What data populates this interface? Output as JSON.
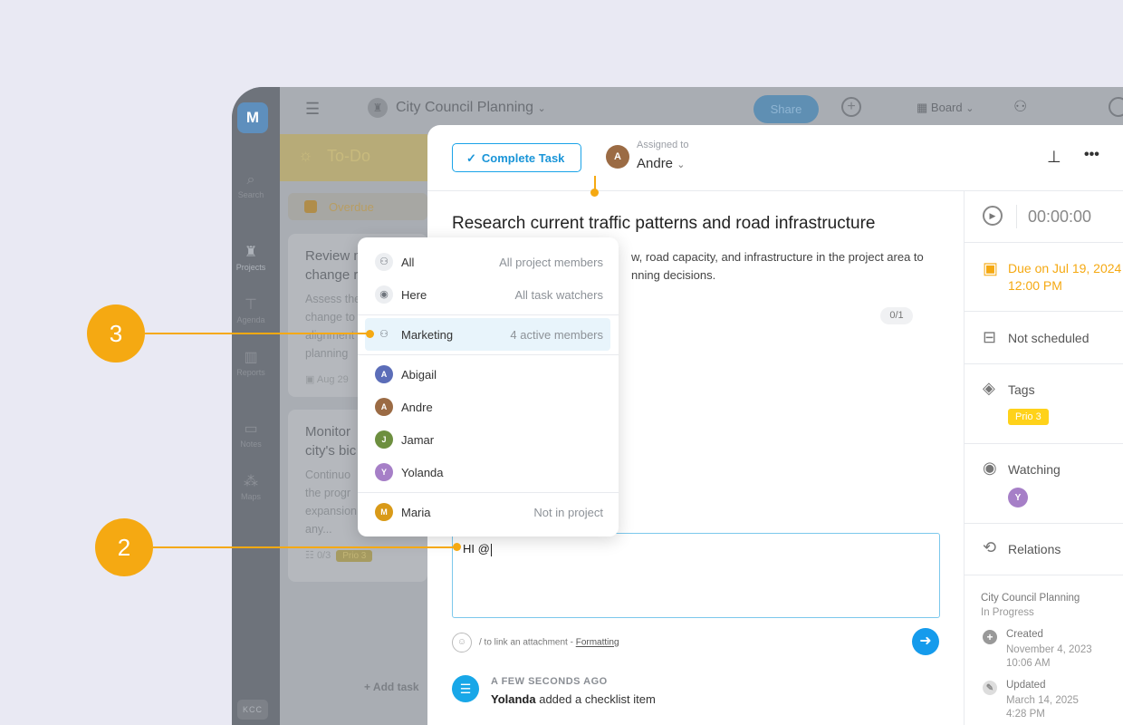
{
  "rail": {
    "logo": "M",
    "items": [
      {
        "label": "Search",
        "glyph": "⚲"
      },
      {
        "label": "Projects",
        "glyph": "♜"
      },
      {
        "label": "Agenda",
        "glyph": "⚲"
      },
      {
        "label": "Reports",
        "glyph": "▥"
      },
      {
        "label": "Notes",
        "glyph": "▭"
      },
      {
        "label": "Maps",
        "glyph": "⁂"
      }
    ],
    "workspace": "KCC"
  },
  "topbar": {
    "project_title": "City Council Planning",
    "share": "Share",
    "board": "Board"
  },
  "column": {
    "title": "To-Do",
    "overdue": "Overdue",
    "card1": {
      "title": "Review m\nchange r",
      "desc": "Assess the\nchange to\nalignment\nplanning",
      "date": "Aug 29"
    },
    "card2": {
      "title": "Monitor\ncity's bic",
      "desc": "Continuo\nthe progr\nexpansion\nany...",
      "checklist": "0/3",
      "prio": "Prio 3"
    },
    "add_task": "Add task"
  },
  "dialog": {
    "complete_label": "Complete Task",
    "assigned_label": "Assigned to",
    "assignee": "Andre",
    "assignee_initials": "A",
    "title": "Research current traffic patterns and road infrastructure",
    "description": "w, road capacity, and infrastructure in the project area to\nnning decisions.",
    "checklist_count": "0/1",
    "editor_text": "HI @",
    "hint_text": "/ to link an attachment - ",
    "formatting": "Formatting",
    "activity": {
      "time": "A FEW SECONDS AGO",
      "user": "Yolanda",
      "text": " added a checklist item"
    }
  },
  "sidebar": {
    "timer": "00:00:00",
    "due": "Due on Jul 19, 2024\n12:00 PM",
    "schedule": "Not scheduled",
    "tags_label": "Tags",
    "tag": "Prio 3",
    "watching_label": "Watching",
    "relations_label": "Relations",
    "project": "City Council Planning",
    "status": "In Progress",
    "created_label": "Created",
    "created_value": "November 4, 2023\n10:06 AM",
    "updated_label": "Updated",
    "updated_value": "March 14, 2025\n4:28 PM"
  },
  "mentions": {
    "all": {
      "label": "All",
      "desc": "All project members"
    },
    "here": {
      "label": "Here",
      "desc": "All task watchers"
    },
    "marketing": {
      "label": "Marketing",
      "desc": "4 active members"
    },
    "members": [
      {
        "name": "Abigail",
        "initials": "A",
        "color": "#5b6db8"
      },
      {
        "name": "Andre",
        "initials": "A",
        "color": "#9b6b44"
      },
      {
        "name": "Jamar",
        "initials": "J",
        "color": "#6d8f3f"
      },
      {
        "name": "Yolanda",
        "initials": "Y",
        "color": "#a67fc7"
      }
    ],
    "outside": {
      "name": "Maria",
      "initials": "M",
      "color": "#d99a18",
      "desc": "Not in project"
    }
  },
  "callouts": {
    "c3": "3",
    "c2": "2"
  },
  "colors": {
    "accent": "#f5a912",
    "primary": "#159bec",
    "due": "#f5a912"
  }
}
